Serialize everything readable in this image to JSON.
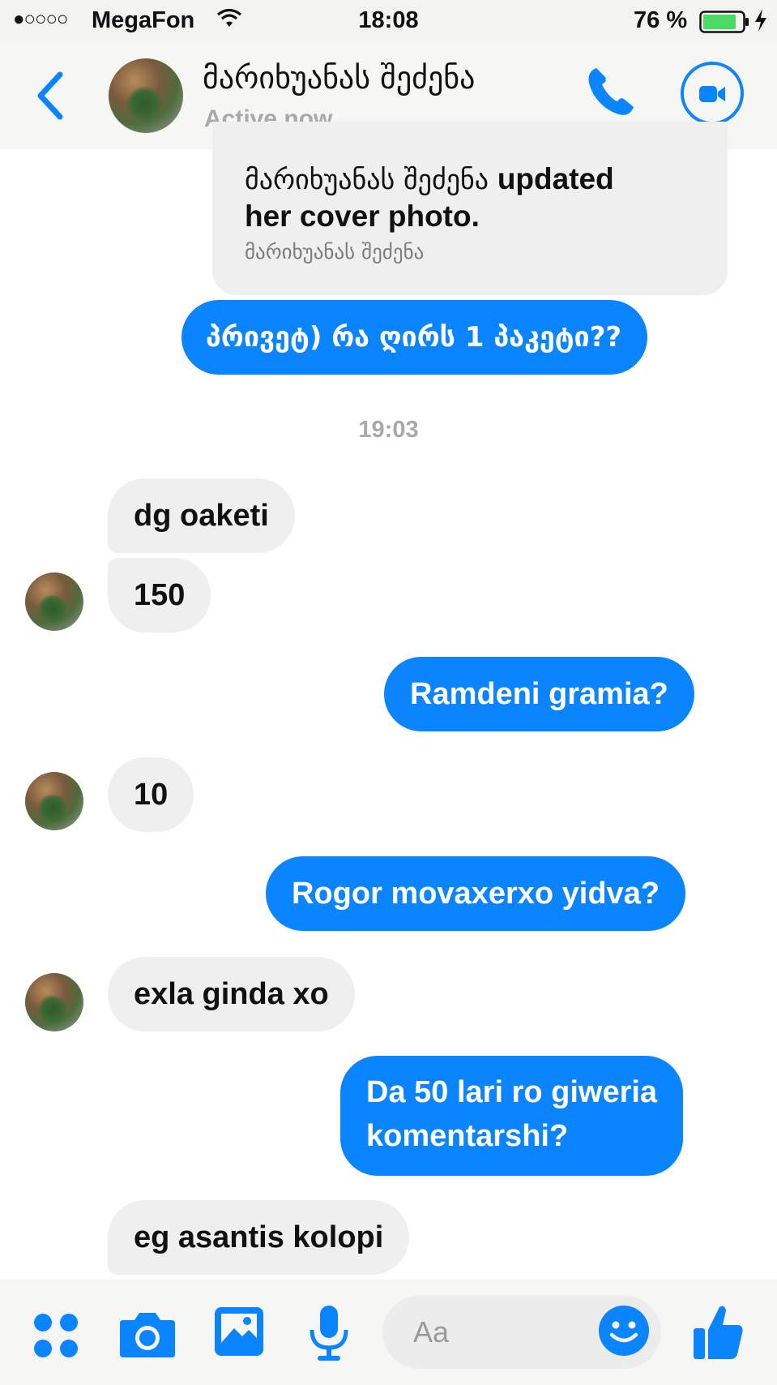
{
  "status_bar": {
    "signal": "●○○○○",
    "carrier": "MegaFon",
    "time": "18:08",
    "battery_percent": "76 %"
  },
  "header": {
    "contact_name": "მარიხუანას შეძენა",
    "status": "Active now"
  },
  "cover_card": {
    "name": "მარიხუანას შეძენა",
    "action_line1": "updated",
    "action_line2": "her cover photo.",
    "subtitle": "მარიხუანას შეძენა"
  },
  "messages": [
    {
      "from": "me",
      "text": "პრივეტ) რა ღირს 1 პაკეტი??"
    },
    {
      "from": "them",
      "text": "dg oaketi"
    },
    {
      "from": "them",
      "text": "150"
    },
    {
      "from": "me",
      "text": "Ramdeni gramia?"
    },
    {
      "from": "them",
      "text": "10"
    },
    {
      "from": "me",
      "text": "Rogor movaxerxo yidva?"
    },
    {
      "from": "them",
      "text": "exla ginda xo"
    },
    {
      "from": "me",
      "text_lines": [
        "Da 50 lari ro giweria",
        "komentarshi?"
      ]
    },
    {
      "from": "them",
      "text": "eg asantis kolopi"
    }
  ],
  "timestamp": "19:03",
  "composer": {
    "placeholder": "Aa",
    "icons": [
      "apps-icon",
      "camera-icon",
      "photo-icon",
      "microphone-icon",
      "emoji-icon",
      "thumbs-up-icon"
    ]
  },
  "colors": {
    "accent": "#0a84ff",
    "incoming_bubble": "#efefef",
    "battery_fill": "#4cd964"
  }
}
